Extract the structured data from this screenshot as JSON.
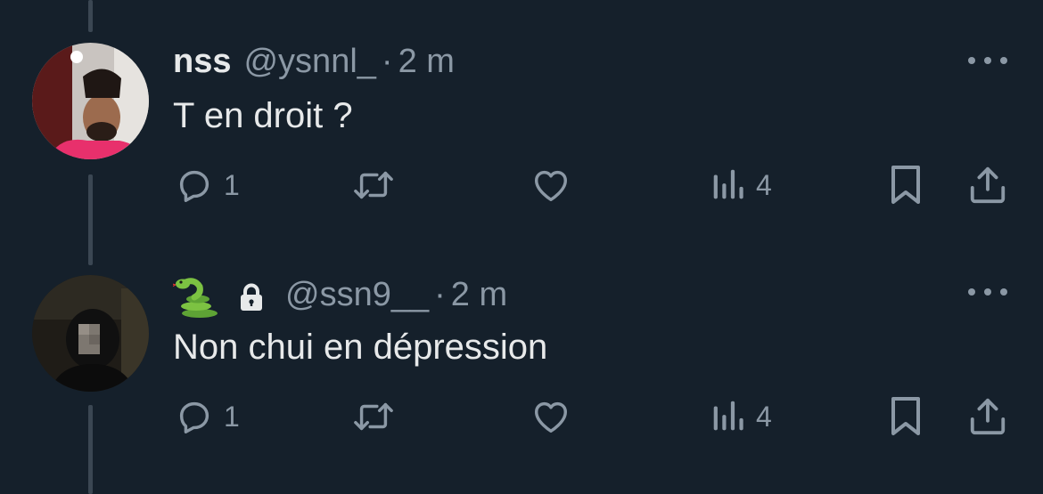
{
  "tweets": [
    {
      "name": "nss",
      "handle": "@ysnnl_",
      "separator": "·",
      "time": "2 m",
      "text": "T en droit ?",
      "reply_count": "1",
      "views_count": "4"
    },
    {
      "name_emoji": "snake-emoji",
      "protected": true,
      "handle": "@ssn9__",
      "separator": "·",
      "time": "2 m",
      "text": "Non chui en dépression",
      "reply_count": "1",
      "views_count": "4"
    }
  ],
  "colors": {
    "background": "#15202b",
    "text": "#e7e9ea",
    "secondary": "#8b98a5",
    "thread_line": "#3b4753"
  }
}
